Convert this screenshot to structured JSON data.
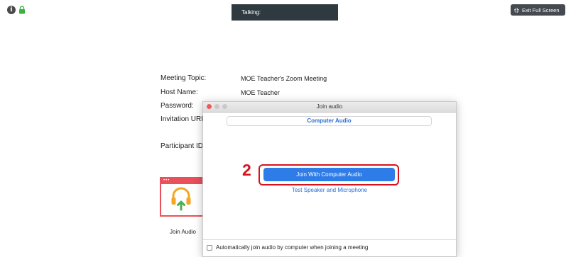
{
  "top": {
    "talking": "Talking:",
    "exit_full_screen": "Exit Full Screen"
  },
  "meeting_info": {
    "topic_label": "Meeting Topic:",
    "topic_value": "MOE Teacher's Zoom Meeting",
    "host_label": "Host Name:",
    "host_value": "MOE Teacher",
    "password_label": "Password:",
    "invitation_label": "Invitation URL",
    "participant_label": "Participant ID"
  },
  "join_audio_card": {
    "label": "Join Audio",
    "dots": "•••"
  },
  "dialog": {
    "title": "Join audio",
    "tab": "Computer Audio",
    "step_number": "2",
    "join_button": "Join With Computer Audio",
    "test_link": "Test Speaker and Microphone",
    "auto_join": "Automatically join audio by computer when joining a meeting",
    "auto_join_checked": false
  },
  "colors": {
    "accent_blue": "#2d7ce8",
    "highlight_red": "#d8121c",
    "card_red": "#e8505b",
    "headset_orange": "#f5a623",
    "arrow_green": "#4caf50"
  }
}
